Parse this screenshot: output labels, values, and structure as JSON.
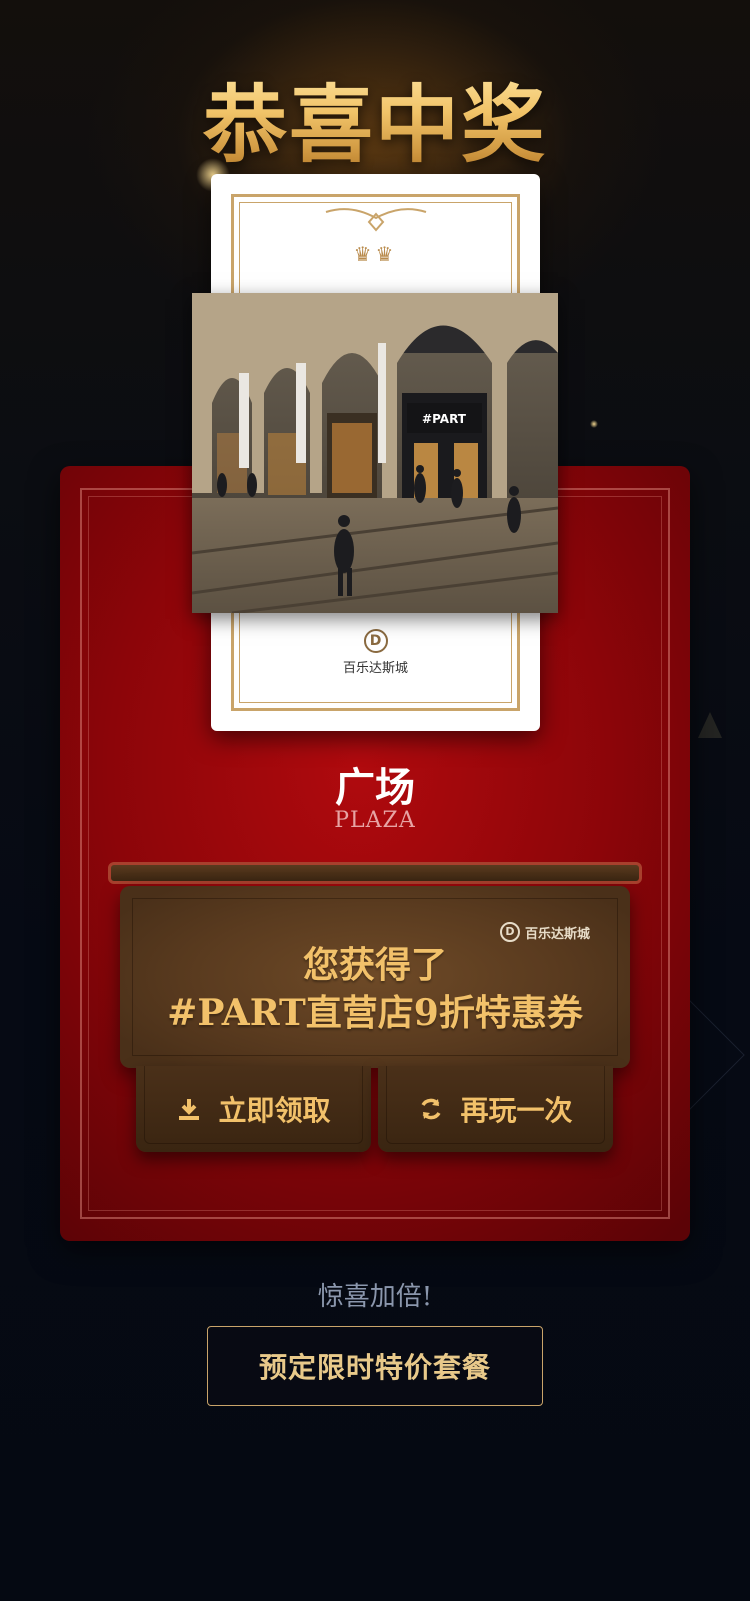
{
  "header": {
    "title": "恭喜中奖"
  },
  "card": {
    "crowns": "♛♛",
    "brand_name": "百乐达斯城",
    "brand_mark": "D",
    "photo_sign": "#PART"
  },
  "prize": {
    "name_cn": "广场",
    "name_en": "PLAZA"
  },
  "coupon": {
    "brand_name": "百乐达斯城",
    "brand_mark": "D",
    "line1": "您获得了",
    "line2": "#PART直营店9折特惠券"
  },
  "actions": {
    "claim_label": "立即领取",
    "claim_icon": "download-icon",
    "replay_label": "再玩一次",
    "replay_icon": "refresh-icon"
  },
  "bonus": {
    "text": "惊喜加倍!",
    "book_label": "预定限时特价套餐"
  },
  "colors": {
    "gold": "#f2c16a",
    "panel_red": "#a0070c",
    "coupon_brown": "#5a3b1f",
    "background": "#070b14"
  }
}
